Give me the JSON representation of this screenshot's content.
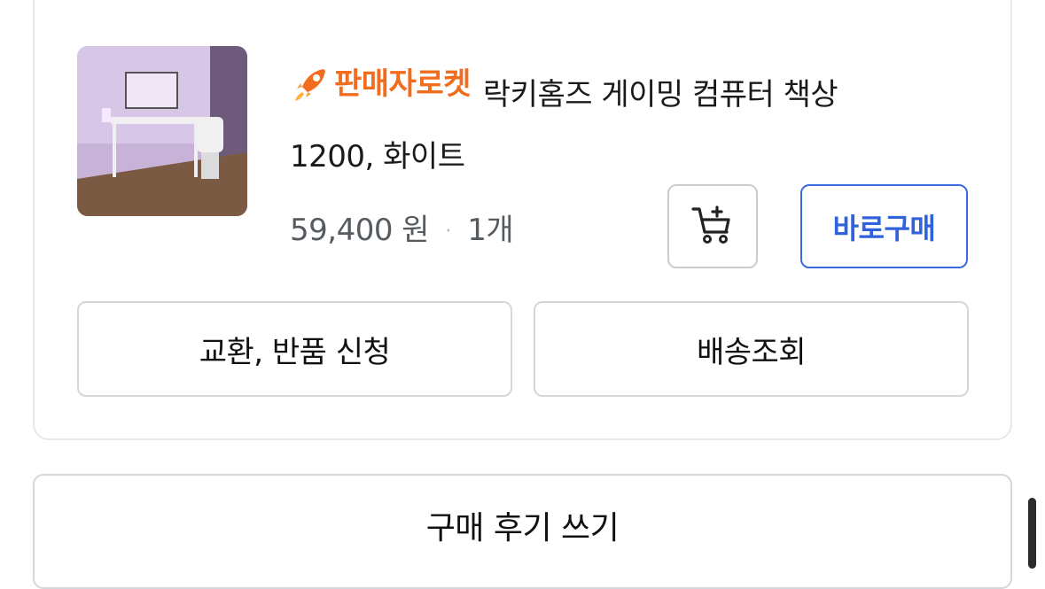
{
  "order_item": {
    "badge_label": "판매자로켓",
    "badge_icon": "rocket-icon",
    "product_name_line1": "락키홈즈 게이밍 컴퓨터 책상",
    "product_name_line2": "1200, 화이트",
    "price": "59,400 원",
    "separator": "·",
    "quantity": "1개",
    "add_to_cart_icon": "cart-plus-icon",
    "buy_now_label": "바로구매",
    "return_label": "교환, 반품 신청",
    "tracking_label": "배송조회",
    "colors": {
      "badge": "#f26c1d",
      "buy_now": "#2f62db"
    }
  },
  "review": {
    "label": "구매 후기 쓰기"
  }
}
